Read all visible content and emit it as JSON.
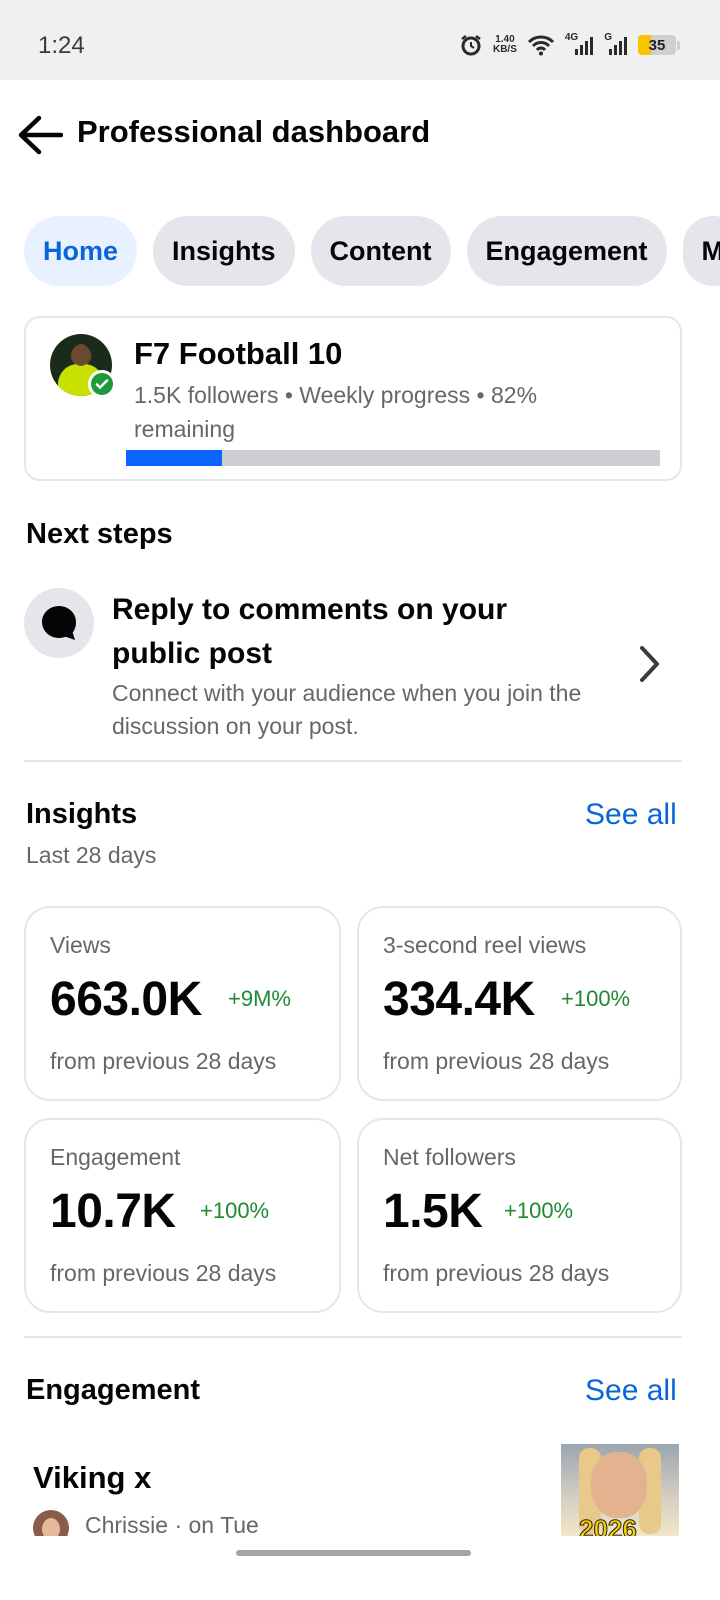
{
  "status_bar": {
    "time": "1:24",
    "speed_value": "1.40",
    "speed_unit": "KB/S",
    "net1": "4G",
    "net2": "G",
    "battery": "35"
  },
  "header": {
    "title": "Professional dashboard",
    "back_icon": "arrow-left-icon"
  },
  "tabs": [
    {
      "label": "Home",
      "active": true
    },
    {
      "label": "Insights",
      "active": false
    },
    {
      "label": "Content",
      "active": false
    },
    {
      "label": "Engagement",
      "active": false
    },
    {
      "label": "M",
      "active": false
    }
  ],
  "profile": {
    "name": "F7 Football 10",
    "meta": "1.5K followers • Weekly progress • 82% remaining",
    "progress_fraction": 0.18,
    "accent": "#0a66ff"
  },
  "next_steps": {
    "title": "Next steps",
    "item": {
      "icon": "comment-bubble-icon",
      "title": "Reply to comments on your public post",
      "description": "Connect with your audience when you join the discussion on your post."
    }
  },
  "insights": {
    "title": "Insights",
    "see_all": "See all",
    "subtitle": "Last 28 days",
    "cards": [
      {
        "label": "Views",
        "value": "663.0K",
        "change": "+9M%",
        "foot": "from previous 28 days"
      },
      {
        "label": "3-second reel views",
        "value": "334.4K",
        "change": "+100%",
        "foot": "from previous 28 days"
      },
      {
        "label": "Engagement",
        "value": "10.7K",
        "change": "+100%",
        "foot": "from previous 28 days"
      },
      {
        "label": "Net followers",
        "value": "1.5K",
        "change": "+100%",
        "foot": "from previous 28 days"
      }
    ]
  },
  "engagement": {
    "title": "Engagement",
    "see_all": "See all",
    "post": {
      "title": "Viking x",
      "meta": "Chrissie · on Tue",
      "thumb_text": "2026"
    }
  }
}
